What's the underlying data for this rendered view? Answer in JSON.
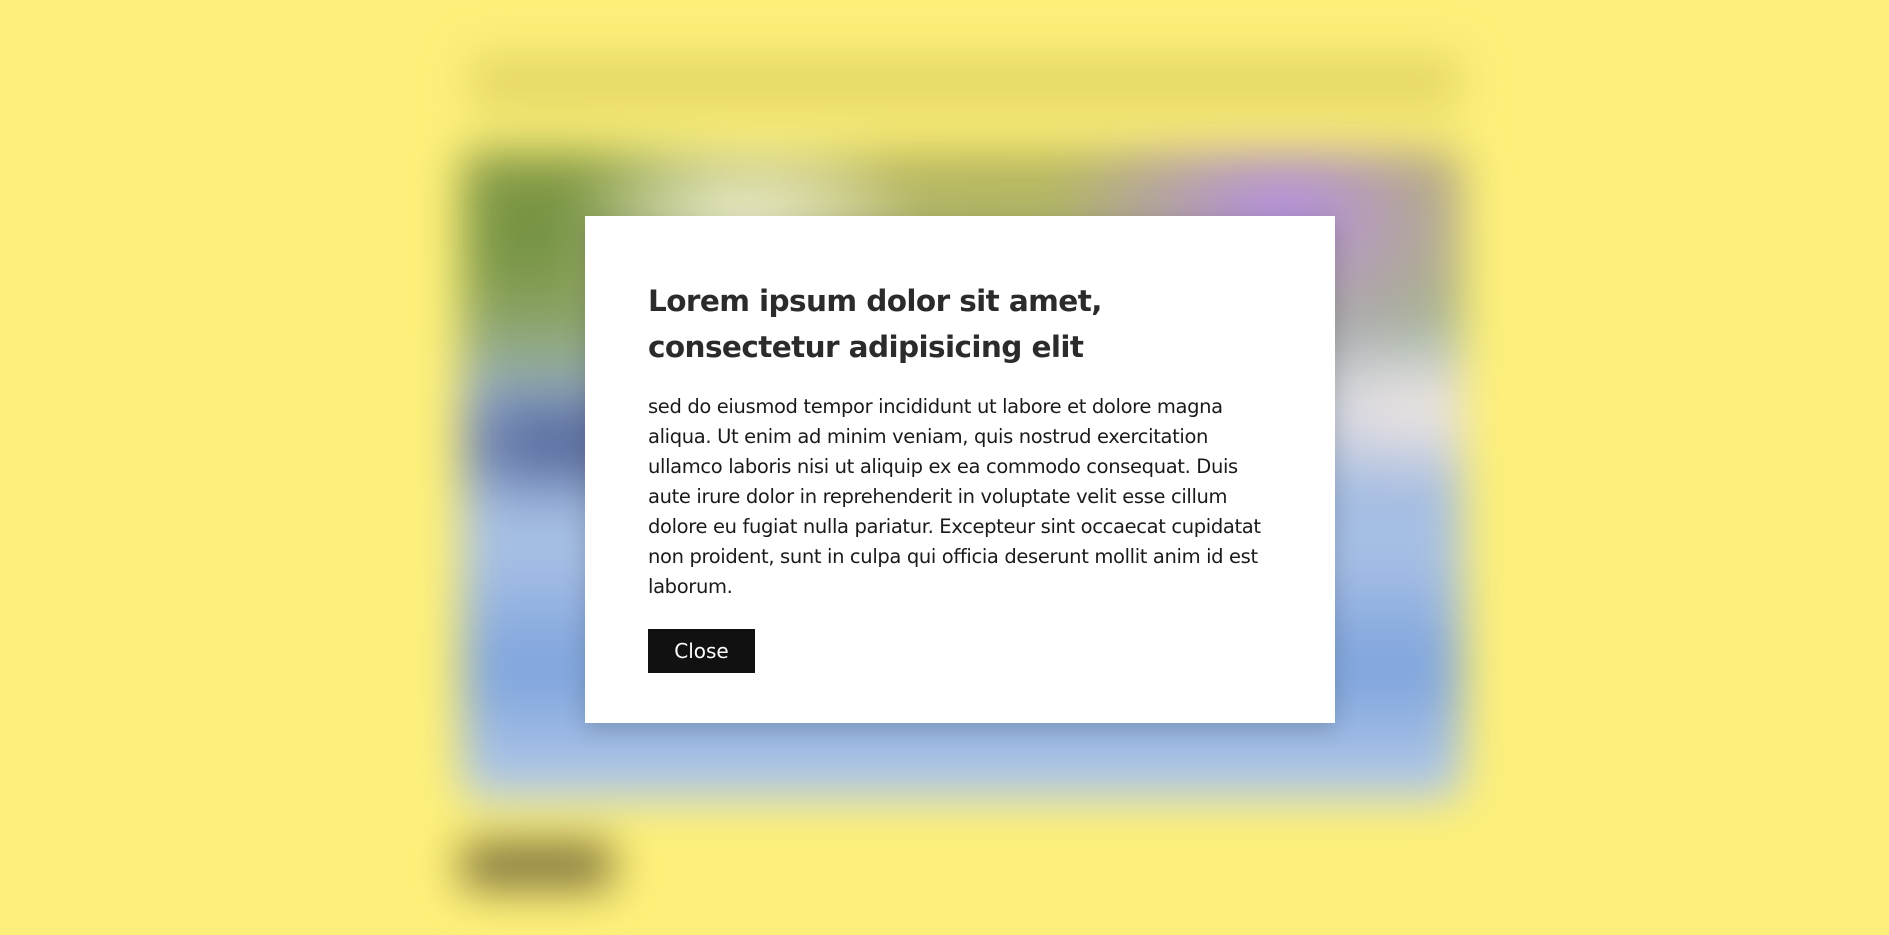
{
  "modal": {
    "title": "Lorem ipsum dolor sit amet, consectetur adipisicing elit",
    "body": "sed do eiusmod tempor incididunt ut labore et dolore magna aliqua. Ut enim ad minim veniam, quis nostrud exercitation ullamco laboris nisi ut aliquip ex ea commodo consequat. Duis aute irure dolor in reprehenderit in voluptate velit esse cillum dolore eu fugiat nulla pariatur. Excepteur sint occaecat cupidatat non proident, sunt in culpa qui officia deserunt mollit anim id est laborum.",
    "close_label": "Close"
  },
  "colors": {
    "page_background": "#fdf07a",
    "modal_background": "#ffffff",
    "button_background": "#111111",
    "button_text": "#ffffff",
    "title_text": "#2b2b2b"
  }
}
